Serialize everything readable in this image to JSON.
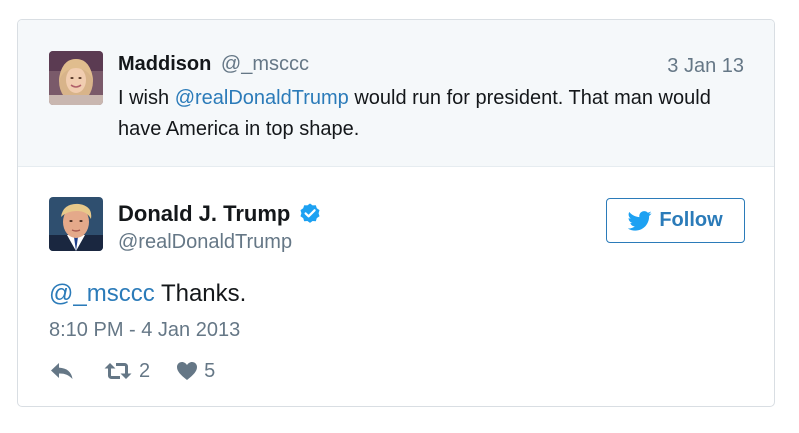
{
  "parent_tweet": {
    "author_name": "Maddison",
    "author_handle": "@_msccc",
    "date": "3 Jan 13",
    "text_before": "I wish ",
    "mention": "@realDonaldTrump",
    "text_after": " would run for president. That man would have America in top shape."
  },
  "main_tweet": {
    "author_name": "Donald J. Trump",
    "author_handle": "@realDonaldTrump",
    "follow_label": "Follow",
    "mention": "@_msccc",
    "text": " Thanks.",
    "timestamp": "8:10 PM - 4 Jan 2013",
    "retweet_count": "2",
    "like_count": "5"
  },
  "colors": {
    "link": "#2b7bb9",
    "muted": "#657786",
    "verified": "#1da1f2",
    "parent_background": "#f5f8fa"
  },
  "icons": {
    "verified": "verified-badge-icon",
    "follow": "twitter-bird-icon",
    "reply": "reply-icon",
    "retweet": "retweet-icon",
    "like": "heart-icon"
  }
}
